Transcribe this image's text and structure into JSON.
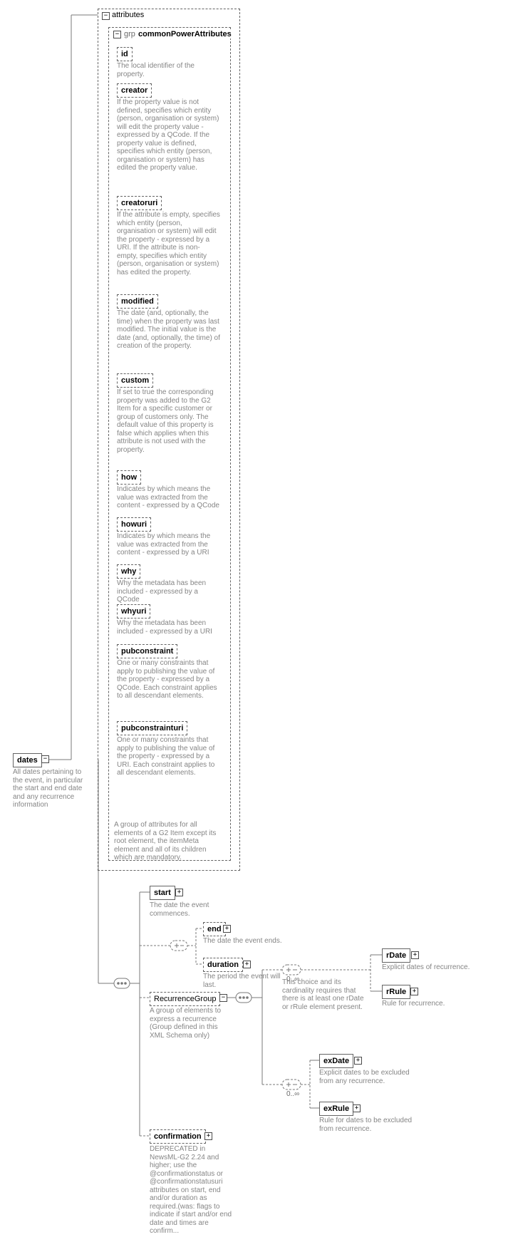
{
  "root": {
    "label": "dates",
    "desc": "All dates pertaining to the event, in particular the start and end date and any recurrence information"
  },
  "attrs_container": {
    "label": "attributes"
  },
  "group": {
    "prefix": "grp",
    "name": "commonPowerAttributes",
    "desc": "A group of attributes for all elements of a G2 Item except its root element, the itemMeta element and all of its children which are mandatory."
  },
  "attrs": [
    {
      "name": "id",
      "desc": "The local identifier of the property."
    },
    {
      "name": "creator",
      "desc": "If the property value is not defined, specifies which entity (person, organisation or system) will edit the property value - expressed by a QCode. If the property value is defined, specifies which entity (person, organisation or system) has edited the property value."
    },
    {
      "name": "creatoruri",
      "desc": "If the attribute is empty, specifies which entity (person, organisation or system) will edit the property - expressed by a URI. If the attribute is non-empty, specifies which entity (person, organisation or system) has edited the property."
    },
    {
      "name": "modified",
      "desc": "The date (and, optionally, the time) when the property was last modified. The initial value is the date (and, optionally, the time) of creation of the property."
    },
    {
      "name": "custom",
      "desc": "If set to true the corresponding property was added to the G2 Item for a specific customer or group of customers only. The default value of this property is false which applies when this attribute is not used with the property."
    },
    {
      "name": "how",
      "desc": "Indicates by which means the value was extracted from the content - expressed by a QCode"
    },
    {
      "name": "howuri",
      "desc": "Indicates by which means the value was extracted from the content - expressed by a URI"
    },
    {
      "name": "why",
      "desc": "Why the metadata has been included - expressed by a QCode"
    },
    {
      "name": "whyuri",
      "desc": "Why the metadata has been included - expressed by a URI"
    },
    {
      "name": "pubconstraint",
      "desc": "One or many constraints that apply to publishing the value of the property - expressed by a QCode. Each constraint applies to all descendant elements."
    },
    {
      "name": "pubconstrainturi",
      "desc": "One or many constraints that apply to publishing the value of the property - expressed by a URI. Each constraint applies to all descendant elements."
    }
  ],
  "start": {
    "label": "start",
    "desc": "The date the event commences."
  },
  "end": {
    "label": "end",
    "desc": "The date the event ends."
  },
  "duration": {
    "label": "duration",
    "desc": "The period the event will last."
  },
  "recgrp": {
    "label": "RecurrenceGroup",
    "desc": "A group of elements to express a recurrence (Group defined in this XML Schema only)"
  },
  "confirm": {
    "label": "confirmation",
    "desc": "DEPRECATED in NewsML-G2 2.24 and higher; use the @confirmationstatus or @confirmationstatusuri attributes on start, end and/or duration as required.(was: flags to indicate if start and/or end date and times are confirm..."
  },
  "choice_desc": "This choice and its cardinality requires that there is at least one rDate or rRule element present.",
  "multiplicity": "0..∞",
  "rDate": {
    "label": "rDate",
    "desc": "Explicit dates of recurrence."
  },
  "rRule": {
    "label": "rRule",
    "desc": "Rule for recurrence."
  },
  "exDate": {
    "label": "exDate",
    "desc": "Explicit dates to be excluded from any recurrence."
  },
  "exRule": {
    "label": "exRule",
    "desc": "Rule for dates to be excluded from recurrence."
  },
  "toggle_minus": "−",
  "toggle_plus": "+",
  "corner_marker": ""
}
